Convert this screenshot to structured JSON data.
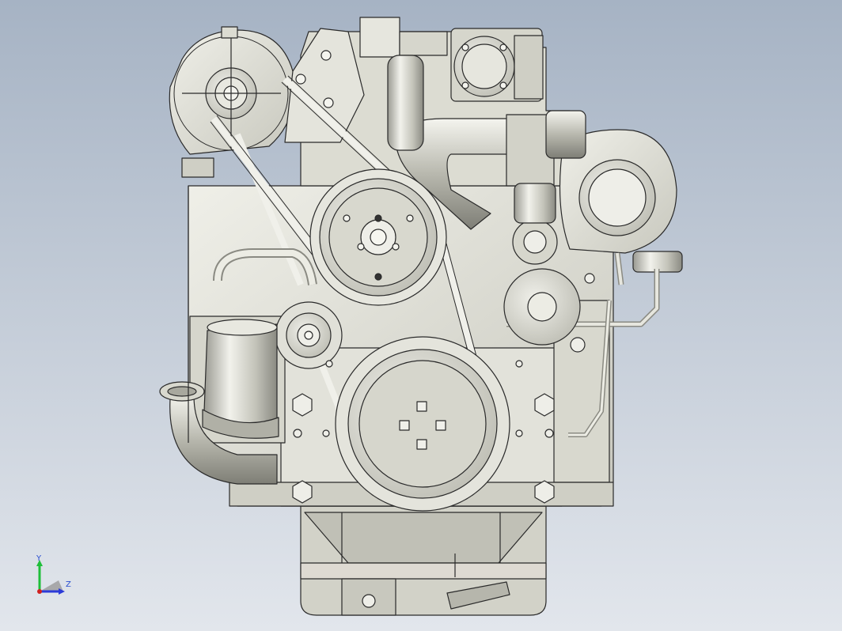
{
  "viewport": {
    "background_top": "#a6b3c4",
    "background_bottom": "#e2e6ec",
    "model_fill": "#dcdcd4",
    "model_shade": "#b4b4aa",
    "model_dark": "#8c8c84",
    "model_line": "#2a2a2a",
    "component": "engine-assembly-front-view"
  },
  "triad": {
    "y_label": "Y",
    "z_label": "Z",
    "y_color": "#1fbf3a",
    "z_color": "#2b3ad8",
    "x_color": "#d02020",
    "label_color": "#2a4fd0"
  }
}
